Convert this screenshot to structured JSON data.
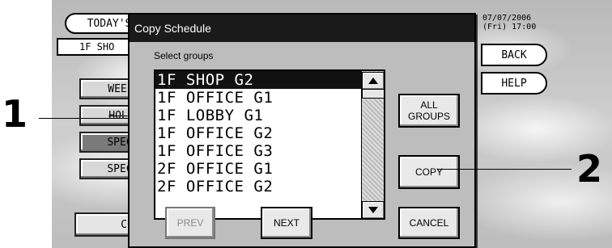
{
  "background": {
    "today_button": "TODAY'S",
    "location_field": "1F SHO",
    "side_buttons": [
      "WEE",
      "HOL",
      "SPEC",
      "SPEC"
    ],
    "bottom_button": "CC",
    "datetime_line1": "07/07/2006",
    "datetime_line2": "(Fri) 17:00",
    "back_label": "BACK",
    "help_label": "HELP"
  },
  "dialog": {
    "title": "Copy Schedule",
    "prompt": "Select groups",
    "groups": [
      "1F SHOP G2",
      "1F OFFICE G1",
      "1F LOBBY G1",
      "1F OFFICE G2",
      "1F OFFICE G3",
      "2F OFFICE G1",
      "2F OFFICE G2"
    ],
    "selected_group": "1F SHOP G2",
    "all_groups_line1": "ALL",
    "all_groups_line2": "GROUPS",
    "copy_label": "COPY",
    "prev_label": "PREV",
    "next_label": "NEXT",
    "cancel_label": "CANCEL"
  },
  "callouts": {
    "left": "1",
    "right": "2"
  },
  "icons": {
    "scroll_up": "triangle-up-icon",
    "scroll_down": "triangle-down-icon"
  },
  "colors": {
    "titlebar": "#1a1a1a",
    "selected_row": "#111111"
  }
}
